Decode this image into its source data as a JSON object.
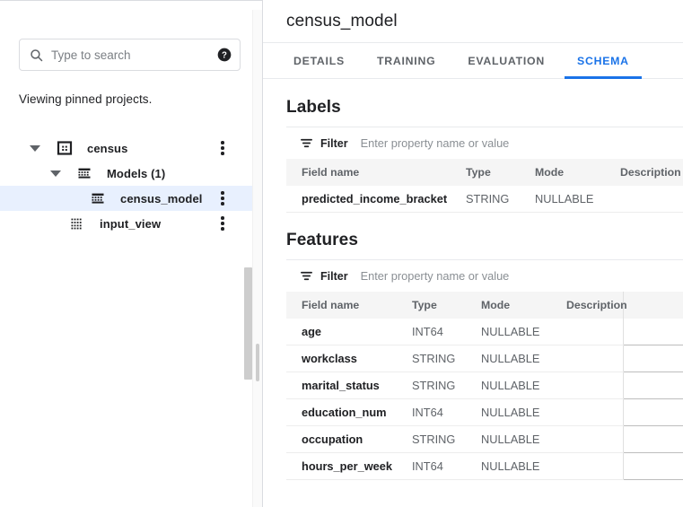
{
  "explorer": {
    "search": {
      "placeholder": "Type to search",
      "value": "",
      "search_icon": "search-icon",
      "help_icon": "help-icon"
    },
    "pinned_note": "Viewing pinned projects.",
    "tree": [
      {
        "label": "census",
        "icon": "project-icon",
        "depth": 0,
        "expanded": true,
        "selected": false,
        "has_menu": true,
        "has_caret": true
      },
      {
        "label": "Models (1)",
        "icon": "models-icon",
        "depth": 1,
        "expanded": true,
        "selected": false,
        "has_menu": false,
        "has_caret": true
      },
      {
        "label": "census_model",
        "icon": "model-icon",
        "depth": 2,
        "expanded": false,
        "selected": true,
        "has_menu": true,
        "has_caret": false
      },
      {
        "label": "input_view",
        "icon": "view-icon",
        "depth": 2,
        "expanded": false,
        "selected": false,
        "has_menu": true,
        "has_caret": false
      }
    ]
  },
  "detail": {
    "title": "census_model",
    "tabs": [
      {
        "label": "DETAILS",
        "active": false
      },
      {
        "label": "TRAINING",
        "active": false
      },
      {
        "label": "EVALUATION",
        "active": false
      },
      {
        "label": "SCHEMA",
        "active": true
      }
    ],
    "accent_color": "#1a73e8",
    "sections": [
      {
        "title": "Labels",
        "filter": {
          "icon": "filter-icon",
          "label": "Filter",
          "placeholder": "Enter property name or value",
          "value": ""
        },
        "columns": [
          "Field name",
          "Type",
          "Mode",
          "Description"
        ],
        "rows": [
          {
            "field_name": "predicted_income_bracket",
            "type": "STRING",
            "mode": "NULLABLE",
            "description": ""
          }
        ]
      },
      {
        "title": "Features",
        "filter": {
          "icon": "filter-icon",
          "label": "Filter",
          "placeholder": "Enter property name or value",
          "value": ""
        },
        "columns": [
          "Field name",
          "Type",
          "Mode",
          "Description"
        ],
        "rows": [
          {
            "field_name": "age",
            "type": "INT64",
            "mode": "NULLABLE",
            "description": ""
          },
          {
            "field_name": "workclass",
            "type": "STRING",
            "mode": "NULLABLE",
            "description": ""
          },
          {
            "field_name": "marital_status",
            "type": "STRING",
            "mode": "NULLABLE",
            "description": ""
          },
          {
            "field_name": "education_num",
            "type": "INT64",
            "mode": "NULLABLE",
            "description": ""
          },
          {
            "field_name": "occupation",
            "type": "STRING",
            "mode": "NULLABLE",
            "description": ""
          },
          {
            "field_name": "hours_per_week",
            "type": "INT64",
            "mode": "NULLABLE",
            "description": ""
          }
        ]
      }
    ]
  }
}
